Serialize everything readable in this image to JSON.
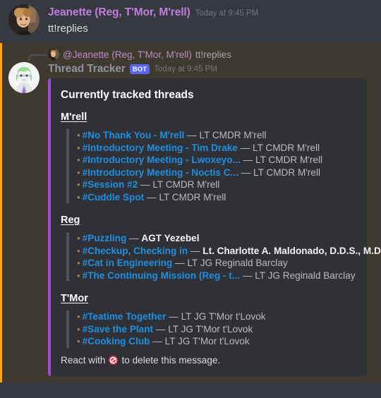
{
  "messages": {
    "first": {
      "author": "Jeanette (Reg, T'Mor, M'rell)",
      "timestamp": "Today at 9:45 PM",
      "content": "tt!replies",
      "author_color": "#c07ee0"
    },
    "second": {
      "reply_mention": "@Jeanette (Reg, T'Mor, M'rell)",
      "reply_content": "tt!replies",
      "bot_name": "Thread Tracker",
      "bot_badge": "BOT",
      "timestamp": "Today at 9:45 PM",
      "bot_name_color": "#8d949f",
      "mention_bar_color": "#faa61a"
    }
  },
  "embed": {
    "accent_color": "#9b4fd0",
    "title": "Currently tracked threads",
    "footer_prefix": "React with",
    "footer_emoji": "no-entry-sign",
    "footer_suffix": "to delete this message.",
    "sections": [
      {
        "header": "M'rell",
        "threads": [
          {
            "name": "#No Thank You - M'rell",
            "owner": "LT CMDR M'rell",
            "owner_bold": false
          },
          {
            "name": "#Introductory Meeting - Tim Drake",
            "owner": "LT CMDR M'rell",
            "owner_bold": false
          },
          {
            "name": "#Introductory Meeting - Lwoxeyo...",
            "owner": "LT CMDR M'rell",
            "owner_bold": false
          },
          {
            "name": "#Introductory Meeting - Noctis C...",
            "owner": "LT CMDR M'rell",
            "owner_bold": false
          },
          {
            "name": "#Session #2",
            "owner": "LT CMDR M'rell",
            "owner_bold": false
          },
          {
            "name": "#Cuddle Spot",
            "owner": "LT CMDR M'rell",
            "owner_bold": false
          }
        ]
      },
      {
        "header": "Reg",
        "threads": [
          {
            "name": "#Puzzling",
            "owner": "AGT Yezebel",
            "owner_bold": true
          },
          {
            "name": "#Checkup, Checking in",
            "owner": "Lt. Charlotte A. Maldonado, D.D.S., M.D.",
            "owner_bold": true
          },
          {
            "name": "#Cat in Engineering",
            "owner": "LT JG Reginald Barclay",
            "owner_bold": false
          },
          {
            "name": "#The Continuing Mission (Reg - t...",
            "owner": "LT JG Reginald Barclay",
            "owner_bold": false
          }
        ]
      },
      {
        "header": "T'Mor",
        "threads": [
          {
            "name": "#Teatime Together",
            "owner": "LT JG T'Mor t'Lovok",
            "owner_bold": false
          },
          {
            "name": "#Save the Plant",
            "owner": "LT JG T'Mor t'Lovok",
            "owner_bold": false
          },
          {
            "name": "#Cooking Club",
            "owner": "LT JG T'Mor t'Lovok",
            "owner_bold": false
          }
        ]
      }
    ]
  }
}
